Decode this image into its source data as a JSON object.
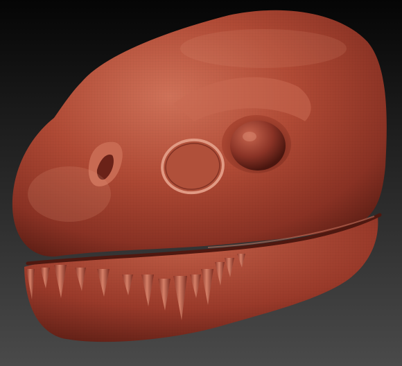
{
  "scene": {
    "subject": "dinosaur-head-sculpt",
    "background_top": "#050505",
    "background_bottom": "#4a4a4a",
    "clay_color": "#a8412f",
    "clay_shadow": "#5b1d14",
    "clay_highlight": "#d9846c"
  }
}
